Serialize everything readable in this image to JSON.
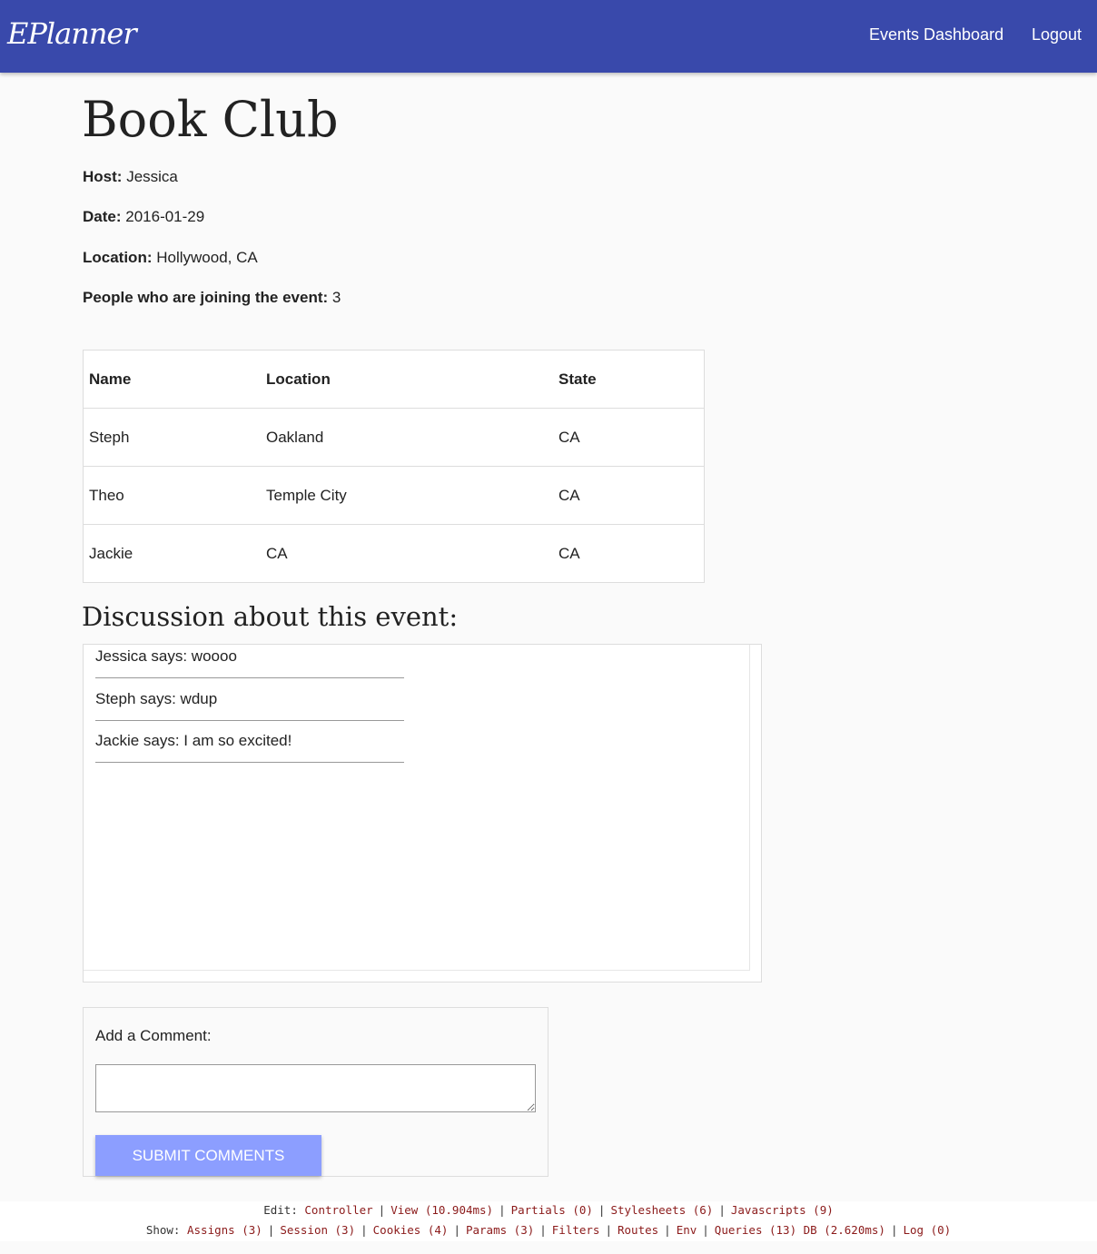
{
  "navbar": {
    "brand": "EPlanner",
    "links": [
      "Events Dashboard",
      "Logout"
    ]
  },
  "event": {
    "title": "Book Club",
    "host_label": "Host:",
    "host": "Jessica",
    "date_label": "Date:",
    "date": "2016-01-29",
    "location_label": "Location:",
    "location": "Hollywood, CA",
    "joining_label": "People who are joining the event:",
    "joining_count": "3"
  },
  "attendees": {
    "headers": [
      "Name",
      "Location",
      "State"
    ],
    "rows": [
      [
        "Steph",
        "Oakland",
        "CA"
      ],
      [
        "Theo",
        "Temple City",
        "CA"
      ],
      [
        "Jackie",
        "CA",
        "CA"
      ]
    ]
  },
  "discussion": {
    "heading": "Discussion about this event:",
    "comments": [
      "Jessica says: woooo",
      "Steph says: wdup",
      "Jackie says: I am so excited!"
    ]
  },
  "comment_form": {
    "label": "Add a Comment:",
    "textarea_value": "",
    "submit_label": "SUBMIT COMMENTS"
  },
  "debug_bar": {
    "edit_label": "Edit:",
    "edit_links": [
      "Controller",
      "View (10.904ms)",
      "Partials (0)",
      "Stylesheets (6)",
      "Javascripts (9)"
    ],
    "show_label": "Show:",
    "show_links": [
      "Assigns (3)",
      "Session (3)",
      "Cookies (4)",
      "Params (3)",
      "Filters",
      "Routes",
      "Env",
      "Queries (13) DB (2.620ms)",
      "Log (0)"
    ]
  },
  "colors": {
    "navbar": "#3949ab",
    "submit_button": "#8c9eff",
    "debug_link": "#8b1a1a"
  }
}
